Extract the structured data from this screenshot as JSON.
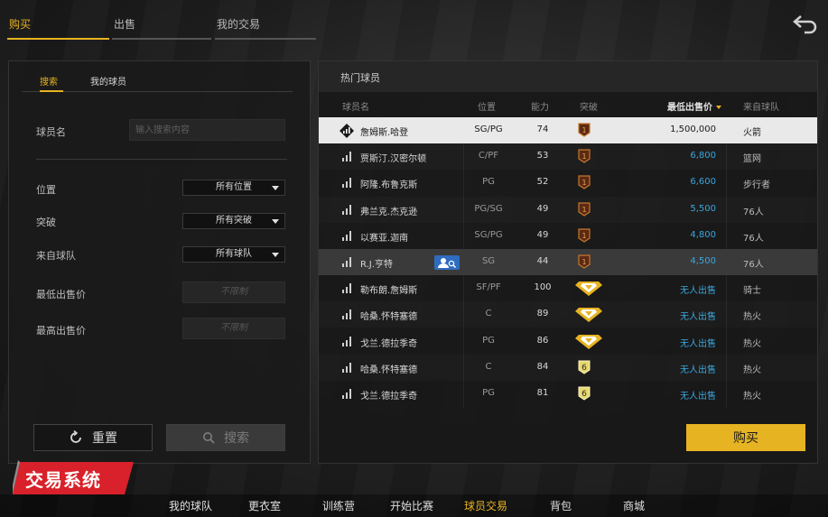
{
  "top_tabs": [
    {
      "label": "购买",
      "active": true
    },
    {
      "label": "出售",
      "active": false
    },
    {
      "label": "我的交易",
      "active": false
    }
  ],
  "left": {
    "sub_tabs": [
      {
        "label": "搜索",
        "active": true
      },
      {
        "label": "我的球员",
        "active": false
      }
    ],
    "name_label": "球员名",
    "name_placeholder": "输入搜索内容",
    "position_label": "位置",
    "position_value": "所有位置",
    "breakthrough_label": "突破",
    "breakthrough_value": "所有突破",
    "team_label": "来自球队",
    "team_value": "所有球队",
    "min_price_label": "最低出售价",
    "min_price_value": "不限制",
    "max_price_label": "最高出售价",
    "max_price_value": "不限制",
    "reset_label": "重置",
    "search_label": "搜索"
  },
  "right": {
    "title": "热门球员",
    "headers": {
      "name": "球员名",
      "position": "位置",
      "overall": "能力",
      "breakthrough": "突破",
      "min_price": "最低出售价",
      "team": "来自球队"
    },
    "buy_label": "购买",
    "players": [
      {
        "name": "詹姆斯.哈登",
        "position": "SG/PG",
        "overall": "74",
        "badge": "1",
        "price": "1,500,000",
        "team": "火箭",
        "selected": true,
        "icon": "diamond"
      },
      {
        "name": "贾斯汀.汉密尔顿",
        "position": "C/PF",
        "overall": "53",
        "badge": "1",
        "price": "6,800",
        "team": "篮网"
      },
      {
        "name": "阿隆.布鲁克斯",
        "position": "PG",
        "overall": "52",
        "badge": "1",
        "price": "6,600",
        "team": "步行者"
      },
      {
        "name": "弗兰克.杰克逊",
        "position": "PG/SG",
        "overall": "49",
        "badge": "1",
        "price": "5,500",
        "team": "76人"
      },
      {
        "name": "以赛亚.迦南",
        "position": "SG/PG",
        "overall": "49",
        "badge": "1",
        "price": "4,800",
        "team": "76人"
      },
      {
        "name": "R.J.亨特",
        "position": "SG",
        "overall": "44",
        "badge": "1",
        "price": "4,500",
        "team": "76人",
        "highlight": true,
        "scout": true
      },
      {
        "name": "勒布朗.詹姆斯",
        "position": "SF/PF",
        "overall": "100",
        "badge": "gem",
        "price": "无人出售",
        "team": "骑士"
      },
      {
        "name": "哈桑.怀特塞德",
        "position": "C",
        "overall": "89",
        "badge": "gem",
        "price": "无人出售",
        "team": "热火"
      },
      {
        "name": "戈兰.德拉季奇",
        "position": "PG",
        "overall": "86",
        "badge": "gem",
        "price": "无人出售",
        "team": "热火"
      },
      {
        "name": "哈桑.怀特塞德",
        "position": "C",
        "overall": "84",
        "badge": "6",
        "price": "无人出售",
        "team": "热火"
      },
      {
        "name": "戈兰.德拉季奇",
        "position": "PG",
        "overall": "81",
        "badge": "6",
        "price": "无人出售",
        "team": "热火"
      }
    ]
  },
  "system_title": "交易系统",
  "bottom_nav": [
    {
      "label": "我的球队",
      "active": false
    },
    {
      "label": "更衣室",
      "active": false
    },
    {
      "label": "训练营",
      "active": false
    },
    {
      "label": "开始比赛",
      "active": false
    },
    {
      "label": "球员交易",
      "active": true
    },
    {
      "label": "背包",
      "active": false
    },
    {
      "label": "商城",
      "active": false
    }
  ],
  "colors": {
    "accent": "#e6b322",
    "price_blue": "#3aa6dd",
    "scout_blue": "#2f6cbf",
    "title_red": "#d8212a"
  }
}
